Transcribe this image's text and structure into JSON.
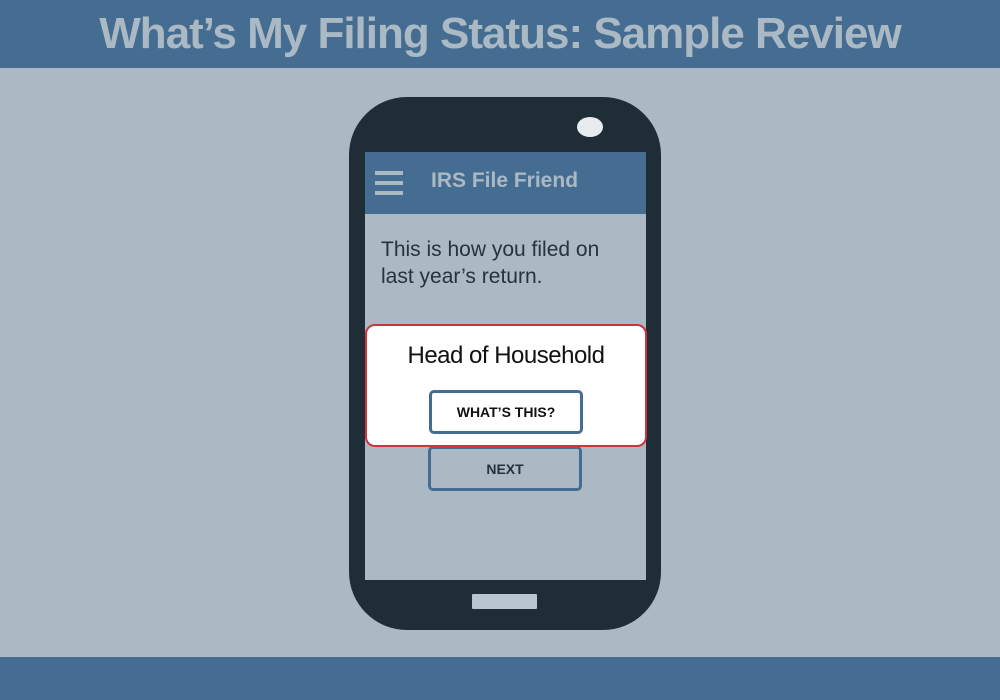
{
  "banner": {
    "title": "What’s My Filing Status: Sample Review"
  },
  "app": {
    "title": "IRS File Friend",
    "menu_icon": "hamburger-menu-icon"
  },
  "screen": {
    "message": "This is how you filed on last year’s return.",
    "filing_status": "Head of Household",
    "whats_this_label": "WHAT’S THIS?",
    "next_label": "NEXT"
  },
  "colors": {
    "banner": "#456d92",
    "background": "#aab9c4",
    "phone_body": "#1f2d36",
    "highlight_border": "#d0343a"
  }
}
